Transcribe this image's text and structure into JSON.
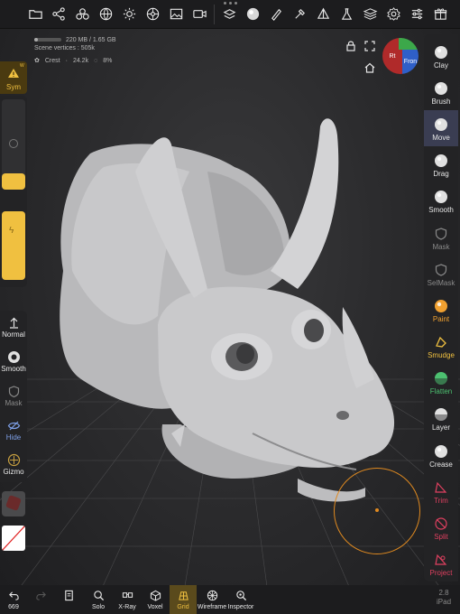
{
  "top_toolbar": {
    "left_icons": [
      "folder-icon",
      "share-graph-icon",
      "scene-icon",
      "globe-icon",
      "sun-icon",
      "settings-wheel-icon",
      "image-icon",
      "video-icon"
    ],
    "right_icons": [
      "sculpt-layer-icon",
      "material-sphere-icon",
      "brush-pen-icon",
      "pipette-icon",
      "triangle-icon",
      "flask-icon",
      "layers-icon",
      "gear-icon",
      "sliders-icon",
      "gift-icon"
    ]
  },
  "info": {
    "memory": "220 MB / 1.65 GB",
    "memory_fraction": 0.13,
    "scene_vertices": "Scene vertices : 505k",
    "object_name": "Crest",
    "object_vertices": "24.2k",
    "mask_percent": "8%"
  },
  "navcube": {
    "right_label": "Fron",
    "left_label": "Rt"
  },
  "left_panel": {
    "sym_label": "Sym",
    "sym_mark": "W",
    "radius_fraction": 0.18,
    "intensity_fraction": 0.55,
    "tools": [
      {
        "label": "Normal"
      },
      {
        "label": "Smooth"
      },
      {
        "label": "Mask"
      },
      {
        "label": "Hide"
      },
      {
        "label": "Gizmo"
      }
    ]
  },
  "right_panel": {
    "tools": [
      {
        "label": "Clay",
        "color": "#e0e0e0"
      },
      {
        "label": "Brush",
        "color": "#e0e0e0"
      },
      {
        "label": "Move",
        "color": "#e0e0e0"
      },
      {
        "label": "Drag",
        "color": "#e0e0e0"
      },
      {
        "label": "Smooth",
        "color": "#e0e0e0"
      },
      {
        "label": "Mask",
        "color": "#888888"
      },
      {
        "label": "SelMask",
        "color": "#888888"
      },
      {
        "label": "Paint",
        "color": "#f0a030"
      },
      {
        "label": "Smudge",
        "color": "#f0c040"
      },
      {
        "label": "Flatten",
        "color": "#4cc070"
      },
      {
        "label": "Layer",
        "color": "#e0e0e0"
      },
      {
        "label": "Crease",
        "color": "#e0e0e0"
      },
      {
        "label": "Trim",
        "color": "#e04060"
      },
      {
        "label": "Split",
        "color": "#e04060"
      },
      {
        "label": "Project",
        "color": "#e04060"
      }
    ]
  },
  "bottom_bar": {
    "undo_count": "669",
    "tools": [
      {
        "label": "Solo"
      },
      {
        "label": "X-Ray"
      },
      {
        "label": "Voxel"
      },
      {
        "label": "Grid"
      },
      {
        "label": "Wireframe"
      },
      {
        "label": "Inspector"
      }
    ],
    "version": "2.8",
    "device": "iPad"
  },
  "colors": {
    "accent": "#f0c040",
    "brush_ring": "#e08a20"
  }
}
